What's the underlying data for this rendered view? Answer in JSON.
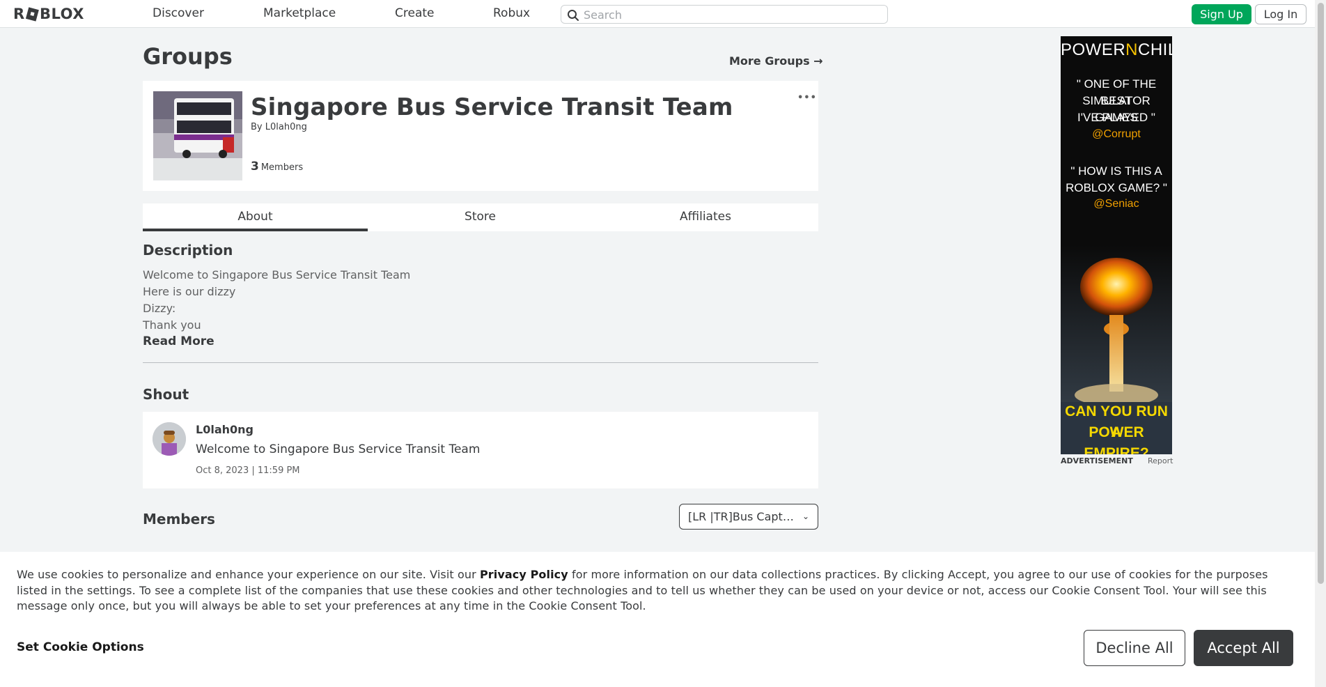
{
  "header": {
    "logo_text": "ROBLOX",
    "nav": [
      "Discover",
      "Marketplace",
      "Create",
      "Robux"
    ],
    "search_placeholder": "Search",
    "signup_label": "Sign Up",
    "login_label": "Log In"
  },
  "page": {
    "title": "Groups",
    "more_groups": "More Groups →"
  },
  "group": {
    "name": "Singapore Bus Service Transit Team",
    "by_prefix": "By",
    "owner": "L0lah0ng",
    "member_count": "3",
    "member_label": "Members",
    "menu_dots": "•••"
  },
  "tabs": [
    {
      "label": "About",
      "active": true
    },
    {
      "label": "Store",
      "active": false
    },
    {
      "label": "Affiliates",
      "active": false
    }
  ],
  "description": {
    "title": "Description",
    "lines": [
      "Welcome to Singapore Bus Service Transit Team",
      "Here is our dizzy",
      "Dizzy:",
      "Thank you"
    ],
    "read_more": "Read More"
  },
  "shout": {
    "title": "Shout",
    "user": "L0lah0ng",
    "text": "Welcome to Singapore Bus Service Transit Team",
    "time": "Oct 8, 2023 | 11:59 PM"
  },
  "members": {
    "title": "Members",
    "role_selected": "[LR |TR]Bus Captain"
  },
  "ad": {
    "brand_a": "POWER",
    "brand_n": "N",
    "brand_b": "CHILL",
    "quote1": [
      "\" ONE OF THE BEST",
      "SIMULATOR GAMES",
      "I'VE PLAYED \""
    ],
    "credit1": "@Corrupt",
    "quote2": [
      "\" HOW IS THIS A",
      "ROBLOX GAME? \""
    ],
    "credit2": "@Seniac",
    "cta": [
      "CAN YOU RUN A",
      "POWER EMPIRE?"
    ],
    "label": "ADVERTISEMENT",
    "report": "Report"
  },
  "cookie": {
    "text_before": "We use cookies to personalize and enhance your experience on our site. Visit our ",
    "link": "Privacy Policy",
    "text_after": " for more information on our data collections practices. By clicking Accept, you agree to our use of cookies for the purposes listed in the settings. To see a complete list of the companies that use these cookies and other technologies and to tell us whether they can be used on your device or not, access our Cookie Consent Tool. Your will see this message only once, but you will always be able to set your preferences at any time in the Cookie Consent Tool.",
    "options_label": "Set Cookie Options",
    "decline_label": "Decline All",
    "accept_label": "Accept All"
  },
  "colors": {
    "page_bg": "#f2f4f5",
    "signup_green": "#00a65a",
    "text_primary": "#393b3d",
    "accept_bg": "#393b3d"
  }
}
